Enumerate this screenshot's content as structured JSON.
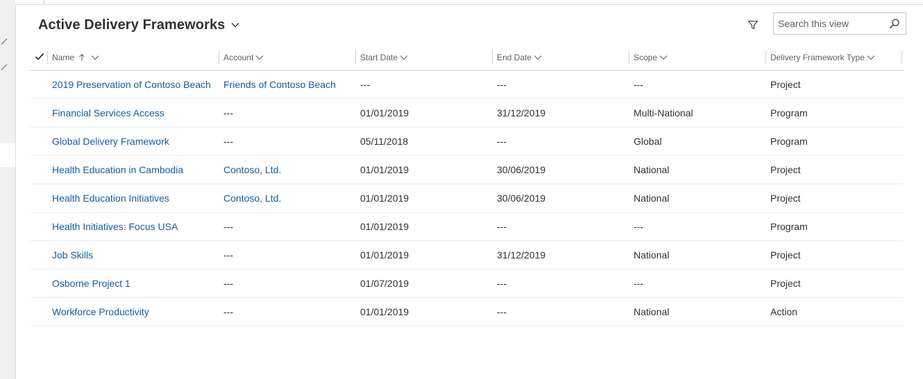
{
  "view": {
    "title": "Active Delivery Frameworks",
    "search_placeholder": "Search this view"
  },
  "columns": [
    {
      "key": "name",
      "label": "Name",
      "sorted": "ascending"
    },
    {
      "key": "account",
      "label": "Account"
    },
    {
      "key": "start_date",
      "label": "Start Date"
    },
    {
      "key": "end_date",
      "label": "End Date"
    },
    {
      "key": "scope",
      "label": "Scope"
    },
    {
      "key": "type",
      "label": "Delivery Framework Type"
    }
  ],
  "rows": [
    {
      "name": "2019 Preservation of Contoso Beach",
      "account": "Friends of Contoso Beach",
      "start_date": "---",
      "end_date": "---",
      "scope": "---",
      "type": "Project"
    },
    {
      "name": "Financial Services Access",
      "account": "---",
      "start_date": "01/01/2019",
      "end_date": "31/12/2019",
      "scope": "Multi-National",
      "type": "Program"
    },
    {
      "name": "Global Delivery Framework",
      "account": "---",
      "start_date": "05/11/2018",
      "end_date": "---",
      "scope": "Global",
      "type": "Program"
    },
    {
      "name": "Health Education in Cambodia",
      "account": "Contoso, Ltd.",
      "start_date": "01/01/2019",
      "end_date": "30/06/2019",
      "scope": "National",
      "type": "Project"
    },
    {
      "name": "Health Education Initiatives",
      "account": "Contoso, Ltd.",
      "start_date": "01/01/2019",
      "end_date": "30/06/2019",
      "scope": "National",
      "type": "Project"
    },
    {
      "name": "Health Initiatives: Focus USA",
      "account": "---",
      "start_date": "01/01/2019",
      "end_date": "---",
      "scope": "---",
      "type": "Program"
    },
    {
      "name": "Job Skills",
      "account": "---",
      "start_date": "01/01/2019",
      "end_date": "31/12/2019",
      "scope": "National",
      "type": "Project"
    },
    {
      "name": "Osborne Project 1",
      "account": "---",
      "start_date": "01/07/2019",
      "end_date": "---",
      "scope": "---",
      "type": "Project"
    },
    {
      "name": "Workforce Productivity",
      "account": "---",
      "start_date": "01/01/2019",
      "end_date": "---",
      "scope": "National",
      "type": "Action"
    }
  ],
  "icons": {
    "title_dropdown": "chevron-down-icon",
    "filter": "filter-icon",
    "search": "search-icon",
    "select_all": "checkmark-icon",
    "sort": "sort-ascending-arrow-icon",
    "column_menu": "chevron-down-icon"
  },
  "colors": {
    "link": "#115ea3",
    "text": "#323130",
    "header_text": "#605e5c",
    "rail_bg": "#f0f0f0"
  }
}
